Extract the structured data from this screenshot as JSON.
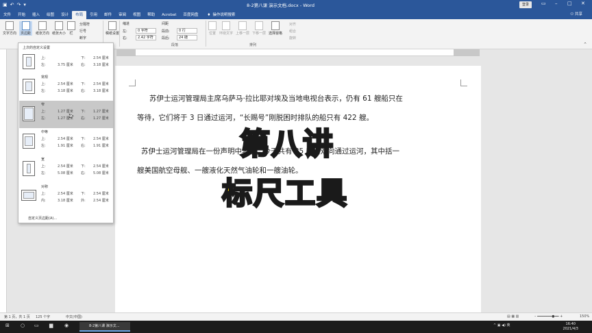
{
  "window": {
    "title": "8-2第八课 演示文档.docx - Word",
    "login": "登录",
    "qat_icons": [
      "save-icon",
      "undo-icon",
      "redo-icon",
      "customize-icon"
    ]
  },
  "tabs": [
    "文件",
    "开始",
    "插入",
    "绘图",
    "设计",
    "布局",
    "引用",
    "邮件",
    "审阅",
    "视图",
    "帮助",
    "Acrobat",
    "百度网盘"
  ],
  "active_tab": "布局",
  "tell_me": "操作说明搜索",
  "share": "共享",
  "ribbon": {
    "text_direction": "文字方向",
    "margins": "页边距",
    "orientation": "纸张方向",
    "size": "纸张大小",
    "columns": "栏",
    "breaks": "分隔符",
    "line_numbers": "行号",
    "hyphenation": "断字",
    "manuscript": "稿纸设置",
    "indent_label": "缩进",
    "spacing_label": "间距",
    "indent_left": "左:",
    "indent_left_val": "0 字符",
    "indent_right": "右:",
    "indent_right_val": "2.42 字符",
    "spacing_before": "段前:",
    "spacing_before_val": "0 行",
    "spacing_after": "段后:",
    "spacing_after_val": "24 磅",
    "position": "位置",
    "wrap_text": "环绕文字",
    "bring_forward": "上移一层",
    "send_backward": "下移一层",
    "selection_pane": "选择窗格",
    "align": "对齐",
    "group": "组合",
    "rotate": "旋转",
    "group_paragraph": "段落",
    "group_arrange": "排列"
  },
  "margins_menu": {
    "top_label": "上次的自定义设置",
    "options": [
      {
        "name": "",
        "top": "上:",
        "top_val": "",
        "bottom": "下:",
        "bottom_val": "2.54 厘米",
        "left": "左:",
        "left_val": "3.75 厘米",
        "right": "右:",
        "right_val": "3.18 厘米"
      },
      {
        "name": "常规",
        "top": "上:",
        "top_val": "2.54 厘米",
        "bottom": "下:",
        "bottom_val": "2.54 厘米",
        "left": "左:",
        "left_val": "3.18 厘米",
        "right": "右:",
        "right_val": "3.18 厘米"
      },
      {
        "name": "窄",
        "top": "上:",
        "top_val": "1.27 厘米",
        "bottom": "下:",
        "bottom_val": "1.27 厘米",
        "left": "左:",
        "left_val": "1.27 厘米",
        "right": "右:",
        "right_val": "1.27 厘米"
      },
      {
        "name": "中等",
        "top": "上:",
        "top_val": "2.54 厘米",
        "bottom": "下:",
        "bottom_val": "2.54 厘米",
        "left": "左:",
        "left_val": "1.91 厘米",
        "right": "右:",
        "right_val": "1.91 厘米"
      },
      {
        "name": "宽",
        "top": "上:",
        "top_val": "2.54 厘米",
        "bottom": "下:",
        "bottom_val": "2.54 厘米",
        "left": "左:",
        "left_val": "5.08 厘米",
        "right": "右:",
        "right_val": "5.08 厘米"
      },
      {
        "name": "对称",
        "top": "上:",
        "top_val": "2.54 厘米",
        "bottom": "下:",
        "bottom_val": "2.54 厘米",
        "left": "内:",
        "left_val": "3.18 厘米",
        "right": "外:",
        "right_val": "2.54 厘米"
      }
    ],
    "custom": "自定义页边距(A)..."
  },
  "document": {
    "line1": "苏伊士运河管理局主席乌萨马·拉比耶对埃及当地电视台表示，仍有 61 艘船只在",
    "line2": "等待，它们将于 3 日通过运河，“长赐号”刚脱困时排队的船只有 422 艘。",
    "line3": "苏伊士运河管理局在一份声明中表示，今天共有 85 艘船双向通过运河，其中括一",
    "line4": "艘美国航空母舰、一艘液化天然气油轮和一艘油轮。"
  },
  "overlay": {
    "title": "第八讲",
    "subtitle": "标尺工具"
  },
  "status": {
    "page": "第 1 页，共 1 页",
    "words": "125 个字",
    "lang": "中文(中国)",
    "zoom": "150%"
  },
  "taskbar": {
    "word_task": "8-2第八课 演示文...",
    "time": "16:40",
    "date": "2021/4/3"
  }
}
